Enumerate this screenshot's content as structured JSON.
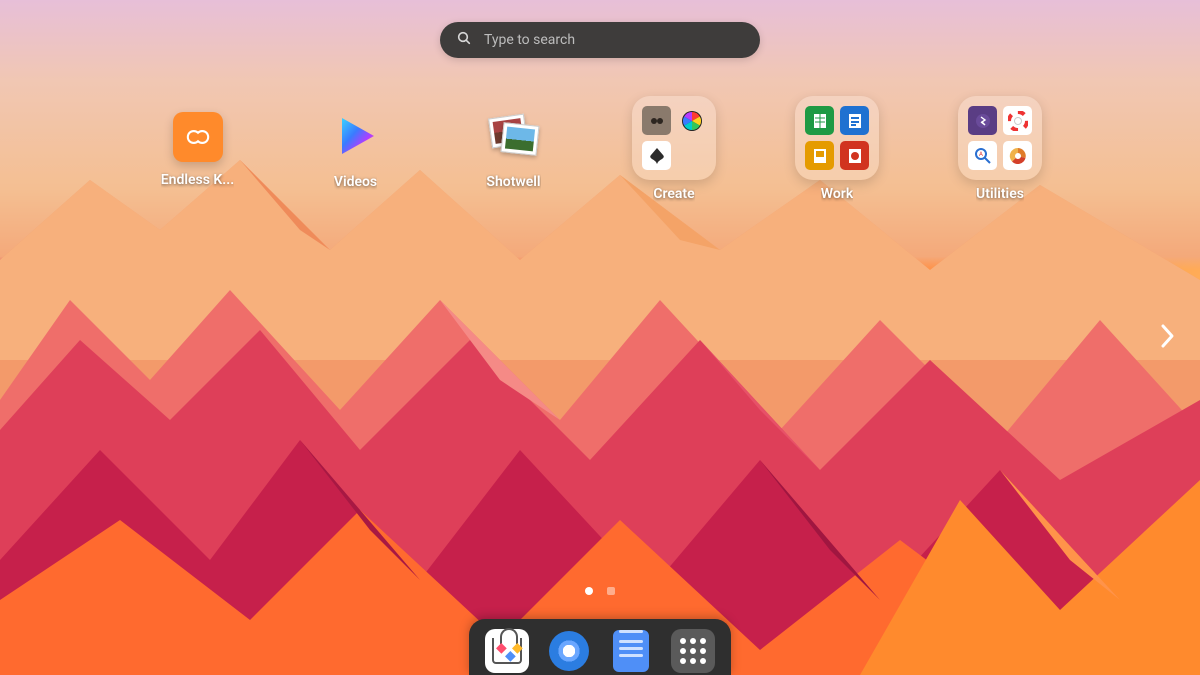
{
  "search": {
    "placeholder": "Type to search",
    "value": ""
  },
  "apps": [
    {
      "id": "endless-key",
      "label": "Endless K...",
      "type": "app"
    },
    {
      "id": "videos",
      "label": "Videos",
      "type": "app"
    },
    {
      "id": "shotwell",
      "label": "Shotwell",
      "type": "app"
    },
    {
      "id": "create",
      "label": "Create",
      "type": "folder",
      "mini_colors": [
        "#7c7268",
        "#3b3b3b",
        "#2f9e46",
        "#ffffff00"
      ],
      "mini_icons": [
        "gimp-icon",
        "color-wheel-icon",
        "inkscape-icon",
        ""
      ]
    },
    {
      "id": "work",
      "label": "Work",
      "type": "folder",
      "mini_colors": [
        "#1f8a3b",
        "#1f6fd1",
        "#e59b00",
        "#d1341f"
      ],
      "mini_icons": [
        "calc-icon",
        "writer-icon",
        "impress-icon",
        "draw-icon"
      ]
    },
    {
      "id": "utilities",
      "label": "Utilities",
      "type": "folder",
      "mini_colors": [
        "#6a4b9a",
        "#ffffff",
        "#ffffff",
        "#d36b1f"
      ],
      "mini_icons": [
        "bluetooth-icon",
        "help-icon",
        "font-viewer-icon",
        "disk-usage-icon"
      ]
    }
  ],
  "pages": {
    "count": 2,
    "active": 0
  },
  "dock": [
    {
      "id": "app-center",
      "name": "app-center"
    },
    {
      "id": "chromium",
      "name": "chromium-browser"
    },
    {
      "id": "files",
      "name": "files"
    },
    {
      "id": "show-apps",
      "name": "show-applications"
    }
  ],
  "colors": {
    "search_bg": "#3e3c3b",
    "dock_bg": "#2f2f2f"
  }
}
